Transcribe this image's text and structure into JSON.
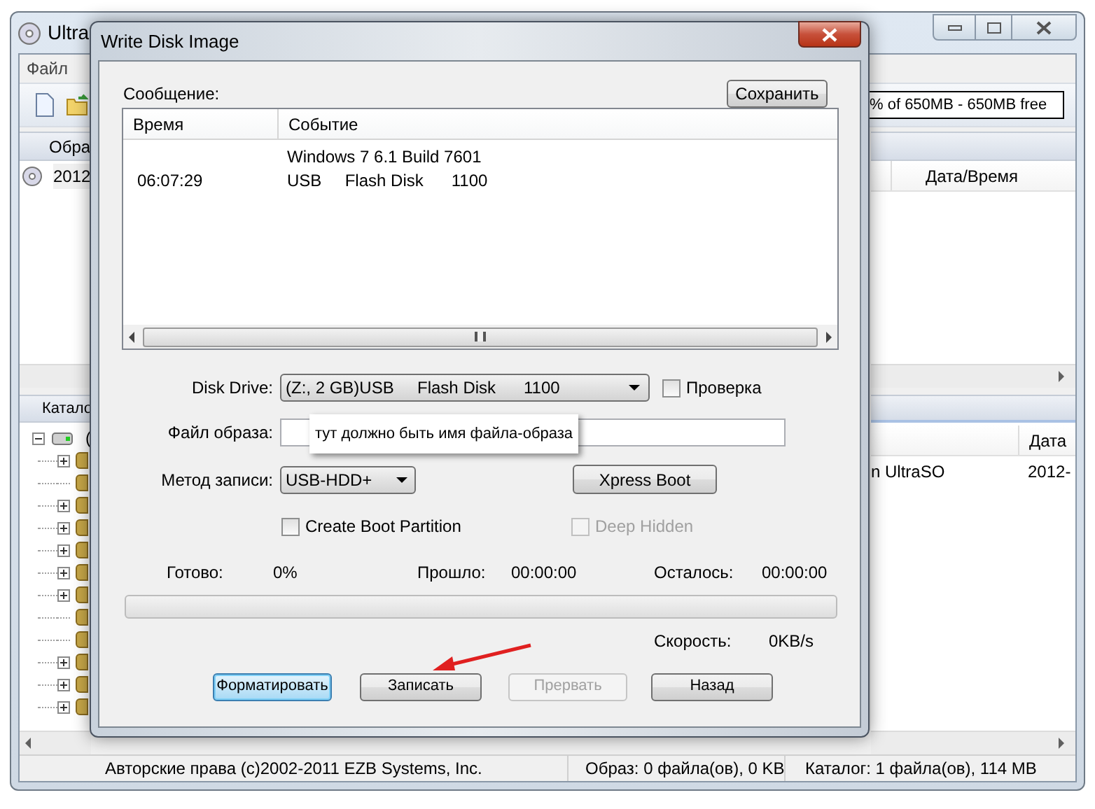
{
  "main_window": {
    "title": "Ultra",
    "menu": [
      "Файл"
    ],
    "capacity": "% of 650MB - 650MB free",
    "image_pane": {
      "header": "Обра",
      "items": [
        {
          "label": "2012"
        }
      ],
      "columns": [
        "Дата/Время"
      ]
    },
    "catalog_pane": {
      "header": "Катало",
      "tree": {
        "label": "(",
        "expanded": true,
        "children": [
          {
            "expandable": true
          },
          {
            "expandable": false
          },
          {
            "expandable": true
          },
          {
            "expandable": true
          },
          {
            "expandable": true
          },
          {
            "expandable": true
          },
          {
            "expandable": true
          },
          {
            "expandable": false
          },
          {
            "expandable": false
          },
          {
            "expandable": true
          },
          {
            "expandable": true
          },
          {
            "expandable": true
          }
        ]
      },
      "columns": [
        "Дата"
      ],
      "rows": [
        {
          "name": "n UltraSO",
          "date": "2012-"
        }
      ]
    },
    "status_bar": [
      "Авторские права (c)2002-2011 EZB Systems, Inc.",
      "Образ: 0 файла(ов), 0 KB",
      "Каталог: 1 файла(ов), 114 MB"
    ]
  },
  "dialog": {
    "title": "Write Disk Image",
    "message_label": "Сообщение:",
    "save_button": "Сохранить",
    "log": {
      "columns": [
        "Время",
        "Событие"
      ],
      "rows": [
        {
          "event": "Windows 7 6.1 Build 7601"
        },
        {
          "time": "06:07:29",
          "event": "USB     Flash Disk      1100"
        }
      ]
    },
    "disk_drive": {
      "label": "Disk Drive:",
      "value": "(Z:, 2 GB)USB     Flash Disk      1100"
    },
    "verify": {
      "label": "Проверка",
      "checked": false
    },
    "image_file": {
      "label": "Файл образа:",
      "tooltip": "тут должно быть имя файла-образа"
    },
    "write_method": {
      "label": "Метод записи:",
      "value": "USB-HDD+"
    },
    "xpress_boot": "Xpress Boot",
    "options": [
      {
        "label": "Create Boot Partition",
        "checked": false,
        "disabled": false
      },
      {
        "label": "Deep Hidden",
        "checked": false,
        "disabled": true
      }
    ],
    "stats": [
      {
        "label": "Готово:",
        "value": "0%"
      },
      {
        "label": "Прошло:",
        "value": "00:00:00"
      },
      {
        "label": "Осталось:",
        "value": "00:00:00"
      }
    ],
    "progress": {
      "level": 0
    },
    "speed": {
      "label": "Скорость:",
      "value": "0KB/s"
    },
    "buttons": [
      {
        "label": "Форматировать",
        "focused": true,
        "disabled": false
      },
      {
        "label": "Записать",
        "focused": false,
        "disabled": false
      },
      {
        "label": "Прервать",
        "focused": false,
        "disabled": true
      },
      {
        "label": "Назад",
        "focused": false,
        "disabled": false
      }
    ]
  }
}
